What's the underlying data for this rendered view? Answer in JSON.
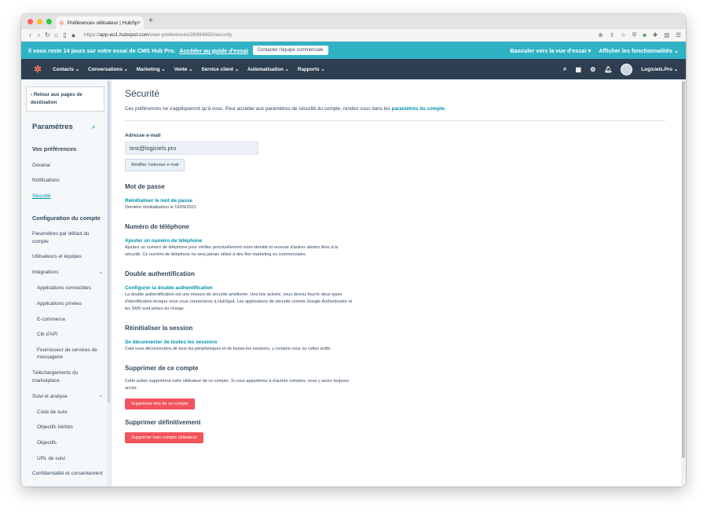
{
  "browser": {
    "tab_title": "Préférences utilisateur | HubSp",
    "tab_close": "×",
    "new_tab": "+",
    "url_scheme": "https://",
    "url_host": "app-eu1.hubspot.com",
    "url_path": "/user-preferences/26994892/security"
  },
  "trial_banner": {
    "message": "Il vous reste 14 jours sur votre essai de CMS Hub Pro.",
    "guide_link": "Accéder au guide d'essai",
    "contact_button": "Contacter l'équipe commerciale",
    "switch_view": "Basculer vers la vue d'essai ▾",
    "show_features": "Afficher les fonctionnalités ⌄"
  },
  "topnav": {
    "items": [
      "Contacts ⌄",
      "Conversations ⌄",
      "Marketing ⌄",
      "Vente ⌄",
      "Service client ⌄",
      "Automatisation ⌄",
      "Rapports ⌄"
    ],
    "account": "Logiciels.Pro ⌄"
  },
  "sidebar": {
    "back": "‹  Retour aux pages de destination",
    "title": "Paramètres",
    "section_prefs": "Vos préférences",
    "prefs_items": [
      "Général",
      "Notifications",
      "Sécurité"
    ],
    "section_config": "Configuration du compte",
    "config_items": [
      "Paramètres par défaut du compte",
      "Utilisateurs et équipes",
      "Intégrations",
      "Applications connectées",
      "Applications privées",
      "E-commerce",
      "Clé d'API",
      "Fournisseur de services de messagerie",
      "Téléchargements du marketplace",
      "Suivi et analyse",
      "Code de suivi",
      "Objectifs hérités",
      "Objectifs",
      "URL de suivi",
      "Confidentialité et consentement"
    ]
  },
  "main": {
    "title": "Sécurité",
    "description": "Ces préférences ne s'appliqueront qu'à vous. Pour accéder aux paramètres de sécurité du compte, rendez-vous dans les ",
    "description_link": "paramètres du compte",
    "description_end": ".",
    "email_label": "Adresse e-mail",
    "email_value": "test@logiciels.pro",
    "email_button": "Modifier l'adresse e-mail",
    "password_heading": "Mot de passe",
    "password_link": "Réinitialiser le mot de passe",
    "password_text": "Dernière réinitialisation le 16/09/2021",
    "phone_heading": "Numéro de téléphone",
    "phone_link": "Ajouter un numéro de téléphone",
    "phone_text": "Ajoutez un numéro de téléphone pour vérifier ponctuellement votre identité et recevoir d'autres alertes liées à la sécurité. Ce numéro de téléphone ne sera jamais utilisé à des fins marketing ou commerciales.",
    "twofa_heading": "Double authentification",
    "twofa_link": "Configurer la double authentification",
    "twofa_text": "La double authentification est une mesure de sécurité améliorée. Une fois activée, vous devrez fournir deux types d'identification lorsque vous vous connecterez à HubSpot. Les applications de sécurité comme Google Authenticator et les SMS sont prises en charge.",
    "session_heading": "Réinitialiser la session",
    "session_link": "Se déconnecter de toutes les sessions",
    "session_text": "Cela vous déconnectera de tous les périphériques et de toutes les sessions, y compris ceux ou celles actifs.",
    "remove_heading": "Supprimer de ce compte",
    "remove_text": "Cette action supprimera votre utilisateur de ce compte. Si vous appartenez à d'autres comptes, vous y aurez toujours accès.",
    "remove_button": "Supprimez-moi de ce compte",
    "delete_heading": "Supprimer définitivement",
    "delete_button": "Supprimer mon compte utilisateur"
  },
  "colors": {
    "trial_banner": "#2fb3c4",
    "topnav": "#2d3e50",
    "link": "#0091ae",
    "danger": "#f2545b",
    "brand": "#ff7a59"
  }
}
